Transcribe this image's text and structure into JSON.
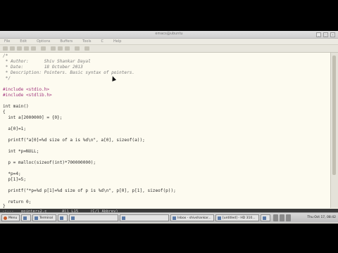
{
  "window": {
    "title": "emacs@ubuntu",
    "controls": [
      "_",
      "□",
      "×"
    ],
    "menu": [
      "File",
      "Edit",
      "Options",
      "Buffers",
      "Tools",
      "C",
      "Help"
    ]
  },
  "code": [
    "/*",
    " * Author:      Shiv Shankar Dayal",
    " * Date:        18 October 2013",
    " * Description: Pointers. Basic syntax of pointers.",
    " */",
    "",
    "#include <stdio.h>",
    "#include <stdlib.h>",
    "",
    "int main()",
    "{",
    "  int a[2000000] = {0};",
    "",
    "  a[0]=1;",
    "",
    "  printf(\"a[0]=%d size of a is %d\\n\", a[0], sizeof(a));",
    "",
    "  int *p=NULL;",
    "",
    "  p = malloc(sizeof(int)*700000000);",
    "",
    "  *p=4;",
    "  p[1]=5;",
    "",
    "  printf(\"*p=%d p[1]=%d size of p is %d\\n\", p[0], p[1], sizeof(p));",
    "",
    "  return 0;",
    "}"
  ],
  "modeline": {
    "status": "-:---",
    "buffer": "pointers2.c",
    "position": "All L15",
    "column": "(C/l Abbrev)"
  },
  "taskbar": {
    "menu": "Menu",
    "tasks": [
      "",
      "Terminal",
      "",
      "",
      "",
      "Inbox - shivshankar...",
      "[untitled] - HD 310...",
      ""
    ],
    "clock": "Thu Oct 17, 08:42"
  }
}
